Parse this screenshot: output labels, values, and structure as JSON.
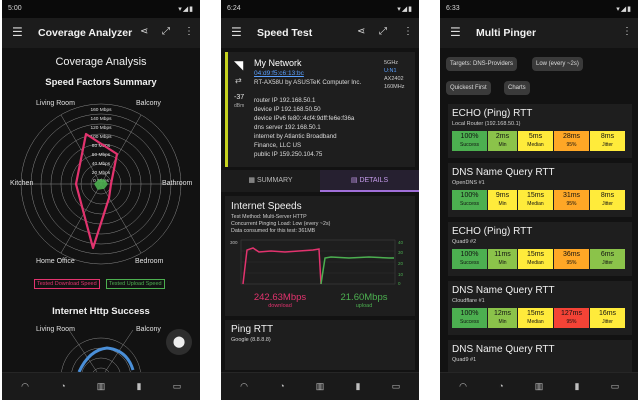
{
  "phones": [
    {
      "status_time": "5:00",
      "title": "Coverage Analyzer",
      "heading": "Coverage Analysis",
      "subheading": "Speed Factors Summary",
      "rooms": [
        "Living Room",
        "Balcony",
        "Kitchen",
        "Bathroom",
        "Home Office",
        "Bedroom"
      ],
      "ring_labels": [
        "160 Mbps",
        "140 Mbps",
        "120 Mbps",
        "100 Mbps",
        "80 Mbps",
        "60 Mbps",
        "40 Mbps",
        "20 Mbps",
        "0 Mbps"
      ],
      "legend": [
        "Tested Download Speed",
        "Tested Upload Speed"
      ],
      "section2": "Internet Http Success",
      "rooms2": [
        "Living Room",
        "Balcony"
      ],
      "colors": {
        "download": "#e2336e",
        "upload": "#4caf50",
        "http": "#4a8fd8"
      }
    },
    {
      "status_time": "6:24",
      "title": "Speed Test",
      "network": {
        "name": "My Network",
        "bssid": "04:d9:f5:c6:13:bc",
        "vendor": "RT-AX58U by ASUSTeK Computer Inc.",
        "band": "5GHz",
        "channel": "U:N1",
        "standard": "AX2402",
        "width": "160MHz",
        "signal": "-37",
        "signal_unit": "dBm",
        "lines": [
          "router IP 192.168.50.1",
          "device IP 192.168.50.50",
          "device IPv6 fe80::4cf4:9dff:fe6e:f36a",
          "dns server 192.168.50.1",
          "internet by Atlantic Broadband",
          "Finance, LLC US",
          "public IP 159.250.104.75"
        ]
      },
      "tabs": [
        "SUMMARY",
        "DETAILS"
      ],
      "internet_speeds": {
        "title": "Internet Speeds",
        "lines": [
          "Test Method: Multi-Server HTTP",
          "Concurrent Pinging Load: Low (every ~2s)",
          "Data consumed for this test: 361MB"
        ],
        "y_max": "300",
        "y_right": [
          "40",
          "30",
          "20",
          "10",
          "0"
        ],
        "download": "242.63Mbps",
        "download_label": "download",
        "upload": "21.60Mbps",
        "upload_label": "upload"
      },
      "ping": {
        "title": "Ping RTT",
        "sub": "Google (8.8.8.8)"
      }
    },
    {
      "status_time": "6:33",
      "title": "Multi Pinger",
      "chips": [
        "Targets: DNS-Providers",
        "Low (every ~2s)",
        "Quickest First",
        "Charts"
      ],
      "cards": [
        {
          "title": "ECHO (Ping) RTT",
          "sub": "Local Router (192.168.50.1)",
          "stats": [
            [
              "100%",
              "Success"
            ],
            [
              "2ms",
              "Min"
            ],
            [
              "5ms",
              "Median"
            ],
            [
              "28ms",
              "95%"
            ],
            [
              "8ms",
              "Jitter"
            ]
          ]
        },
        {
          "title": "DNS Name Query RTT",
          "sub": "OpenDNS #1",
          "stats": [
            [
              "100%",
              "Success"
            ],
            [
              "9ms",
              "Min"
            ],
            [
              "15ms",
              "Median"
            ],
            [
              "31ms",
              "95%"
            ],
            [
              "8ms",
              "Jitter"
            ]
          ]
        },
        {
          "title": "ECHO (Ping) RTT",
          "sub": "Quad9 #2",
          "stats": [
            [
              "100%",
              "Success"
            ],
            [
              "11ms",
              "Min"
            ],
            [
              "15ms",
              "Median"
            ],
            [
              "36ms",
              "95%"
            ],
            [
              "6ms",
              "Jitter"
            ]
          ]
        },
        {
          "title": "DNS Name Query RTT",
          "sub": "Cloudflare #1",
          "stats": [
            [
              "100%",
              "Success"
            ],
            [
              "12ms",
              "Min"
            ],
            [
              "15ms",
              "Median"
            ],
            [
              "127ms",
              "95%"
            ],
            [
              "16ms",
              "Jitter"
            ]
          ]
        },
        {
          "title": "DNS Name Query RTT",
          "sub": "Quad9 #1",
          "stats": []
        }
      ],
      "stat_colors": [
        [
          "#4caf50",
          "#8bc34a",
          "#ffeb3b",
          "#ffa726",
          "#ffeb3b"
        ],
        [
          "#4caf50",
          "#ffeb3b",
          "#ffeb3b",
          "#ffa726",
          "#ffeb3b"
        ],
        [
          "#4caf50",
          "#8bc34a",
          "#ffeb3b",
          "#ffa726",
          "#8bc34a"
        ],
        [
          "#4caf50",
          "#8bc34a",
          "#ffeb3b",
          "#f44336",
          "#ffeb3b"
        ]
      ]
    }
  ]
}
